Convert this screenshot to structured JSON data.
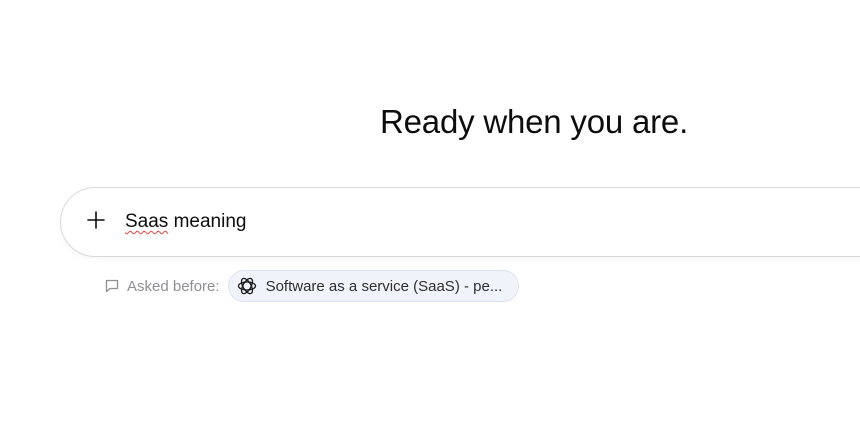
{
  "headline": "Ready when you are.",
  "composer": {
    "value_prefix": "Saas",
    "value_rest": " meaning",
    "add_icon": "plus-icon"
  },
  "asked_before": {
    "icon": "chat-bubble-icon",
    "label": "Asked before:",
    "suggestion": {
      "logo": "chatgpt-logo-icon",
      "text": "Software as a service (SaaS) - pe..."
    }
  },
  "colors": {
    "pill_background": "#f0f3fa",
    "pill_border": "#dbe2f0",
    "muted_text": "#8e8e93",
    "spellcheck_underline": "#e0463b"
  }
}
